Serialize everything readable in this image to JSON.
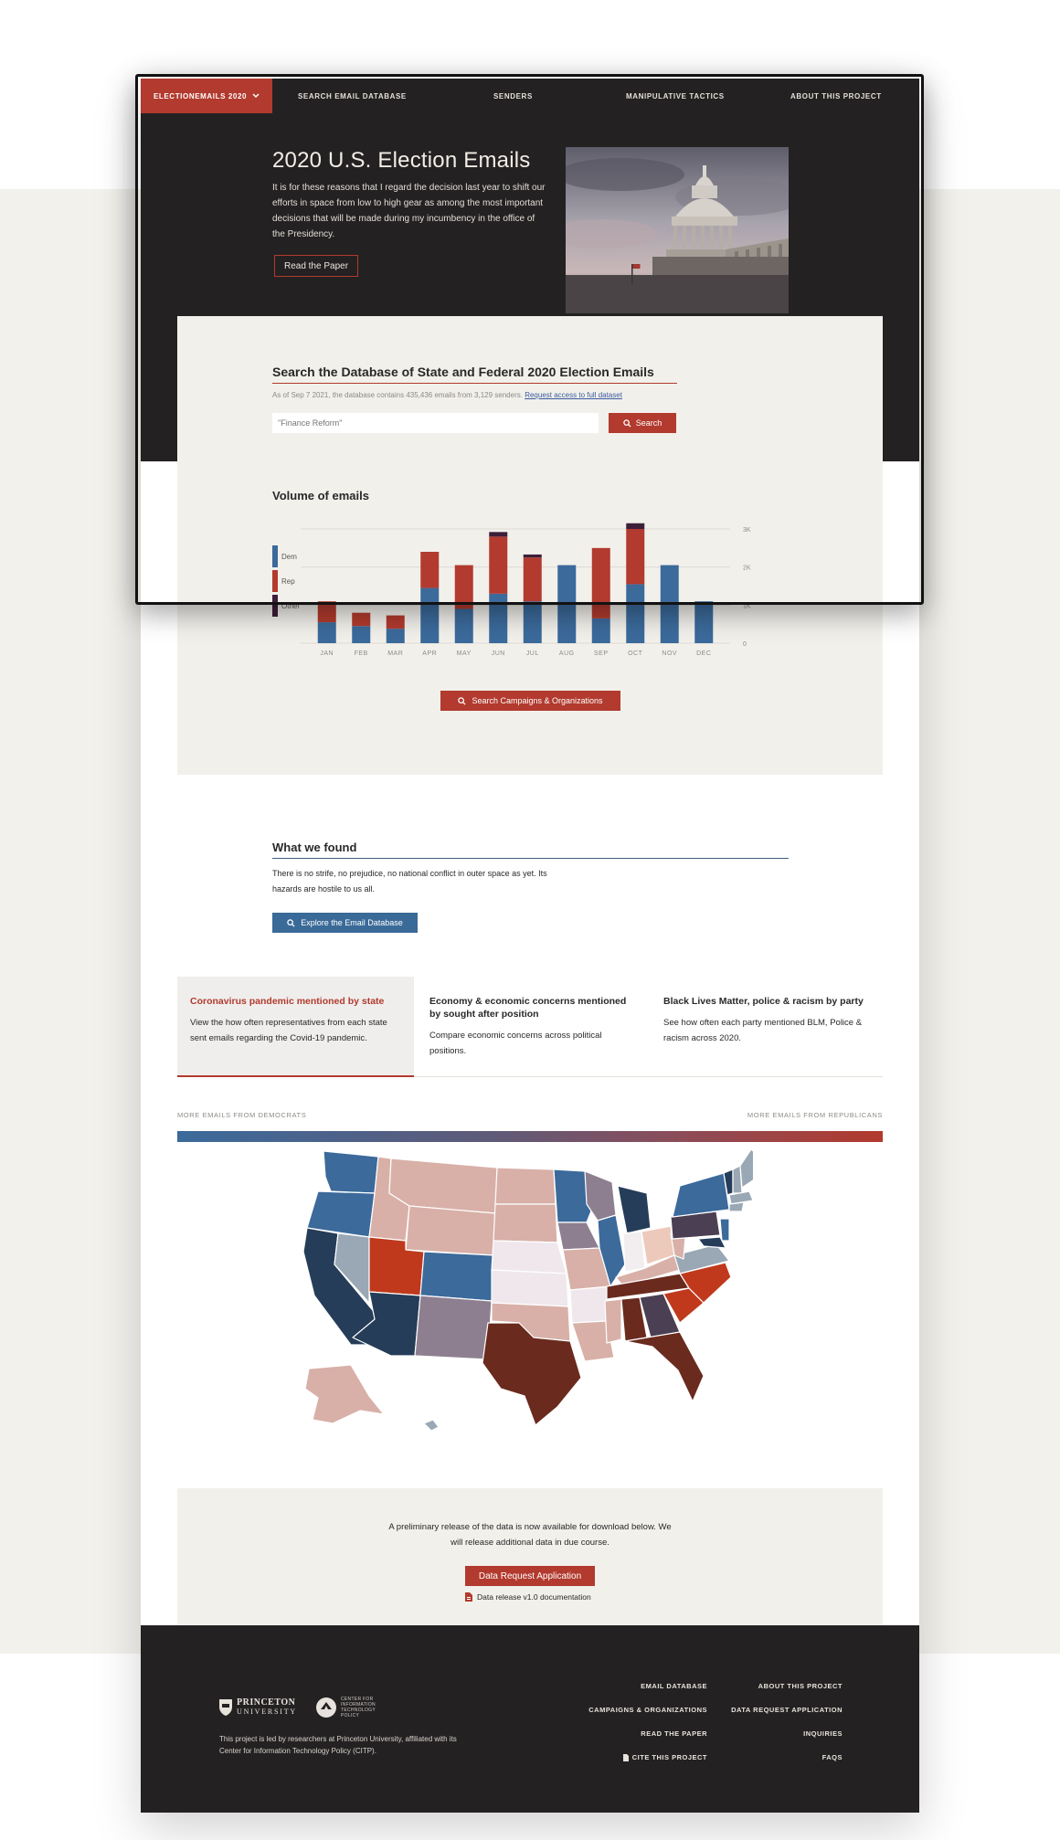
{
  "nav": {
    "brand": "ELECTIONEMAILS 2020",
    "items": [
      "SEARCH EMAIL DATABASE",
      "SENDERS",
      "MANIPULATIVE TACTICS",
      "ABOUT THIS PROJECT"
    ]
  },
  "hero": {
    "title": "2020 U.S. Election Emails",
    "text": "It is for these reasons that I regard the decision last year to shift our efforts in space from low to high gear as among the most important decisions that will be made during my incumbency in the office of the Presidency.",
    "button": "Read the Paper"
  },
  "search": {
    "title": "Search the Database of State and Federal 2020 Election Emails",
    "meta": "As of Sep 7 2021, the database contains 435,436 emails from 3,129 senders.",
    "meta_link": "Request access to full dataset",
    "placeholder": "\"Finance Reform\"",
    "button": "Search"
  },
  "volume": {
    "title": "Volume of emails",
    "button": "Search Campaigns & Organizations"
  },
  "chart_data": {
    "type": "bar",
    "stacked": true,
    "categories": [
      "JAN",
      "FEB",
      "MAR",
      "APR",
      "MAY",
      "JUN",
      "JUL",
      "AUG",
      "SEP",
      "OCT",
      "NOV",
      "DEC"
    ],
    "series": [
      {
        "name": "Dem",
        "color": "#3b6a9b",
        "values": [
          550,
          450,
          380,
          1450,
          900,
          1300,
          1100,
          2050,
          650,
          1550,
          2050,
          1100
        ]
      },
      {
        "name": "Rep",
        "color": "#b23a2e",
        "values": [
          550,
          350,
          350,
          950,
          1150,
          1500,
          1150,
          0,
          1850,
          1450,
          0,
          0
        ]
      },
      {
        "name": "Other",
        "color": "#3d1f3a",
        "values": [
          0,
          0,
          0,
          0,
          0,
          120,
          80,
          0,
          0,
          150,
          0,
          0
        ]
      }
    ],
    "yticks": [
      "0",
      "1K",
      "2K",
      "3K"
    ],
    "ylim": [
      0,
      3000
    ],
    "grid": true,
    "legend": "left"
  },
  "found": {
    "title": "What we found",
    "text": "There is no strife, no prejudice, no national conflict in outer space as yet. Its hazards are hostile to us all.",
    "button": "Explore the Email Database"
  },
  "cards": [
    {
      "title": "Coronavirus pandemic mentioned by state",
      "text": "View the how often representatives from each state sent emails regarding the Covid-19 pandemic."
    },
    {
      "title": "Economy & economic concerns mentioned by sought after position",
      "text": "Compare economic concerns across  political positions."
    },
    {
      "title": "Black Lives Matter, police & racism by party",
      "text": "See how often each party mentioned BLM, Police & racism across 2020."
    }
  ],
  "map_legend": {
    "left": "MORE EMAILS FROM DEMOCRATS",
    "right": "MORE EMAILS FROM REPUBLICANS"
  },
  "release": {
    "text": "A preliminary release of the data is now available for download below. We will release additional data in due course.",
    "button": "Data Request Application",
    "doc": "Data release v1.0 documentation"
  },
  "footer": {
    "university": "PRINCETON",
    "university_sub": "UNIVERSITY",
    "citp": "CENTER FOR INFORMATION TECHNOLOGY POLICY",
    "text": "This project is led by researchers at Princeton University, affiliated with its Center for Information Technology Policy (CITP).",
    "col1": [
      "EMAIL DATABASE",
      "CAMPAIGNS & ORGANIZATIONS",
      "READ THE PAPER",
      "CITE THIS PROJECT"
    ],
    "col2": [
      "ABOUT THIS PROJECT",
      "DATA REQUEST APPLICATION",
      "INQUIRIES",
      "FAQS"
    ]
  }
}
